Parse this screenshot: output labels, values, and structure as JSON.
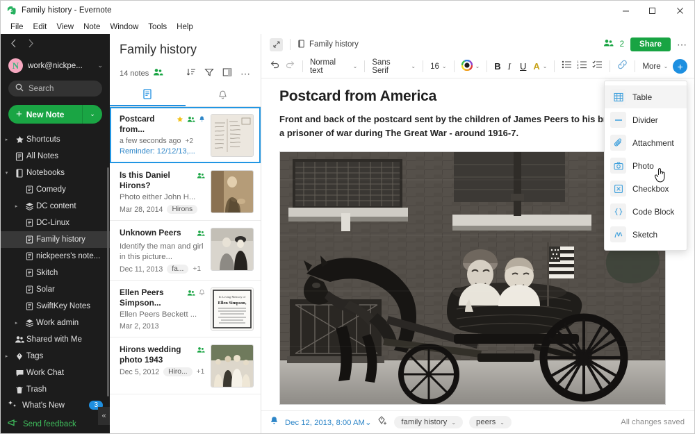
{
  "window": {
    "title": "Family history - Evernote",
    "logo_icon": "evernote-elephant-icon",
    "minimize_label": "–",
    "maximize_label": "□",
    "close_label": "✕"
  },
  "menubar": {
    "items": [
      {
        "label": "File"
      },
      {
        "label": "Edit"
      },
      {
        "label": "View"
      },
      {
        "label": "Note"
      },
      {
        "label": "Window"
      },
      {
        "label": "Tools"
      },
      {
        "label": "Help"
      }
    ]
  },
  "sidebar": {
    "back_icon": "chevron-left-icon",
    "forward_icon": "chevron-right-icon",
    "account": {
      "avatar_initial": "N",
      "name": "work@nickpe...",
      "chevron": "⌄"
    },
    "search": {
      "placeholder": "Search",
      "icon": "search-icon"
    },
    "new_note": {
      "label": "New Note",
      "plus": "+",
      "caret": "⌄"
    },
    "items": [
      {
        "label": "Shortcuts",
        "icon": "star-icon",
        "twisty": "▸",
        "indent": 0
      },
      {
        "label": "All Notes",
        "icon": "note-icon",
        "twisty": "",
        "indent": 0
      },
      {
        "label": "Notebooks",
        "icon": "notebook-icon",
        "twisty": "▾",
        "indent": 0
      },
      {
        "label": "Comedy",
        "icon": "note-icon",
        "twisty": "",
        "indent": 1
      },
      {
        "label": "DC content",
        "icon": "stack-icon",
        "twisty": "▸",
        "indent": 1
      },
      {
        "label": "DC-Linux",
        "icon": "note-icon",
        "twisty": "",
        "indent": 1
      },
      {
        "label": "Family history",
        "icon": "note-icon",
        "twisty": "",
        "indent": 1,
        "selected": true
      },
      {
        "label": "nickpeers's note...",
        "icon": "note-icon",
        "twisty": "",
        "indent": 1
      },
      {
        "label": "Skitch",
        "icon": "note-icon",
        "twisty": "",
        "indent": 1
      },
      {
        "label": "Solar",
        "icon": "note-icon",
        "twisty": "",
        "indent": 1
      },
      {
        "label": "SwiftKey Notes",
        "icon": "note-icon",
        "twisty": "",
        "indent": 1
      },
      {
        "label": "Work admin",
        "icon": "stack-icon",
        "twisty": "▸",
        "indent": 1
      },
      {
        "label": "Shared with Me",
        "icon": "people-icon",
        "twisty": "",
        "indent": 0
      },
      {
        "label": "Tags",
        "icon": "tag-icon",
        "twisty": "▸",
        "indent": 0
      },
      {
        "label": "Work Chat",
        "icon": "chat-icon",
        "twisty": "",
        "indent": 0
      },
      {
        "label": "Trash",
        "icon": "trash-icon",
        "twisty": "",
        "indent": 0
      }
    ],
    "whats_new": {
      "label": "What's New",
      "badge": "3",
      "icon": "sparkle-icon"
    },
    "feedback": {
      "label": "Send feedback",
      "icon": "megaphone-icon"
    },
    "collapse": {
      "label": "«",
      "icon": "collapse-sidebar-icon"
    }
  },
  "notelist": {
    "title": "Family history",
    "count_label": "14 notes",
    "shared_icon": "people-icon",
    "tools": [
      {
        "icon": "sort-icon"
      },
      {
        "icon": "filter-icon"
      },
      {
        "icon": "view-layout-icon"
      },
      {
        "icon": "more-icon"
      }
    ],
    "tabs": [
      {
        "icon": "notes-tab-icon",
        "active": true
      },
      {
        "icon": "reminder-bell-icon",
        "active": false
      }
    ],
    "notes": [
      {
        "title": "Postcard from...",
        "snippet": "",
        "date": "a few seconds ago",
        "plus_tags": "+2",
        "reminder": "Reminder: 12/12/13,...",
        "icons": [
          "star-icon",
          "people-icon",
          "bell-icon"
        ],
        "selected": true,
        "thumb": "handwritten-postcard"
      },
      {
        "title": "Is this Daniel Hirons?",
        "snippet": "Photo either John H...",
        "date": "Mar 28, 2014",
        "tag": "Hirons",
        "plus_tags": "",
        "reminder": "",
        "icons": [
          "people-icon"
        ],
        "selected": false,
        "thumb": "sepia-seated-man"
      },
      {
        "title": "Unknown Peers",
        "snippet": "Identify the man and girl in this picture...",
        "date": "Dec 11, 2013",
        "tag": "fa...",
        "plus_tags": "+1",
        "reminder": "",
        "icons": [
          "people-icon"
        ],
        "selected": false,
        "thumb": "couple-photo"
      },
      {
        "title": "Ellen Peers Simpson...",
        "snippet": "Ellen Peers Beckett ...",
        "date": "Mar 2, 2013",
        "tag": "",
        "plus_tags": "",
        "reminder": "",
        "icons": [
          "people-icon",
          "bell-icon"
        ],
        "selected": false,
        "thumb": "memorial-card"
      },
      {
        "title": "Hirons wedding photo 1943",
        "snippet": "",
        "date": "Dec 5, 2012",
        "tag": "Hiro...",
        "plus_tags": "+1",
        "reminder": "",
        "icons": [
          "people-icon"
        ],
        "selected": false,
        "thumb": "wedding-group"
      }
    ]
  },
  "editor": {
    "expand_icon": "expand-note-icon",
    "notebook_icon": "notebook-icon",
    "notebook_name": "Family history",
    "share_count": "2",
    "share_count_icon": "people-icon",
    "share_button": "Share",
    "more_icon": "more-icon",
    "toolbar": {
      "undo_icon": "undo-icon",
      "redo_icon": "redo-icon",
      "paragraph_style": "Normal text",
      "font_family": "Sans Serif",
      "font_size": "16",
      "color_icon": "color-wheel-icon",
      "bold": "B",
      "italic": "I",
      "underline": "U",
      "highlight": "A",
      "bullet_list_icon": "bullet-list-icon",
      "numbered_list_icon": "numbered-list-icon",
      "checklist_icon": "checklist-icon",
      "link_icon": "link-icon",
      "more_label": "More",
      "insert_plus": "+",
      "caret": "⌄"
    },
    "note": {
      "heading": "Postcard from America",
      "paragraph_line1": "Front and back of the postcard sent by the children of James Peers to his brot",
      "paragraph_line2": "a prisoner of war during The Great War - around 1916-7.",
      "image_alt": "Two children in a horse-drawn cart, vintage black and white photograph"
    },
    "status": {
      "reminder_icon": "bell-icon",
      "date": "Dec 12, 2013, 8:00 AM",
      "date_caret": "⌄",
      "add_tag_icon": "add-tag-icon",
      "tags": [
        {
          "label": "family history",
          "caret": "⌄"
        },
        {
          "label": "peers",
          "caret": "⌄"
        }
      ],
      "saved_text": "All changes saved"
    }
  },
  "insert_menu": {
    "items": [
      {
        "label": "Table",
        "icon": "table-icon",
        "highlighted": true
      },
      {
        "label": "Divider",
        "icon": "divider-icon",
        "highlighted": false
      },
      {
        "label": "Attachment",
        "icon": "paperclip-icon",
        "highlighted": false
      },
      {
        "label": "Photo",
        "icon": "camera-icon",
        "highlighted": false
      },
      {
        "label": "Checkbox",
        "icon": "checkbox-icon",
        "highlighted": false
      },
      {
        "label": "Code Block",
        "icon": "code-block-icon",
        "highlighted": false
      },
      {
        "label": "Sketch",
        "icon": "sketch-icon",
        "highlighted": false
      }
    ],
    "cursor_icon": "hand-pointer-cursor"
  },
  "colors": {
    "accent_green": "#18a443",
    "accent_blue": "#1f8fe0",
    "sidebar_bg": "#1c1c1c",
    "selection_border": "#2196e3"
  }
}
